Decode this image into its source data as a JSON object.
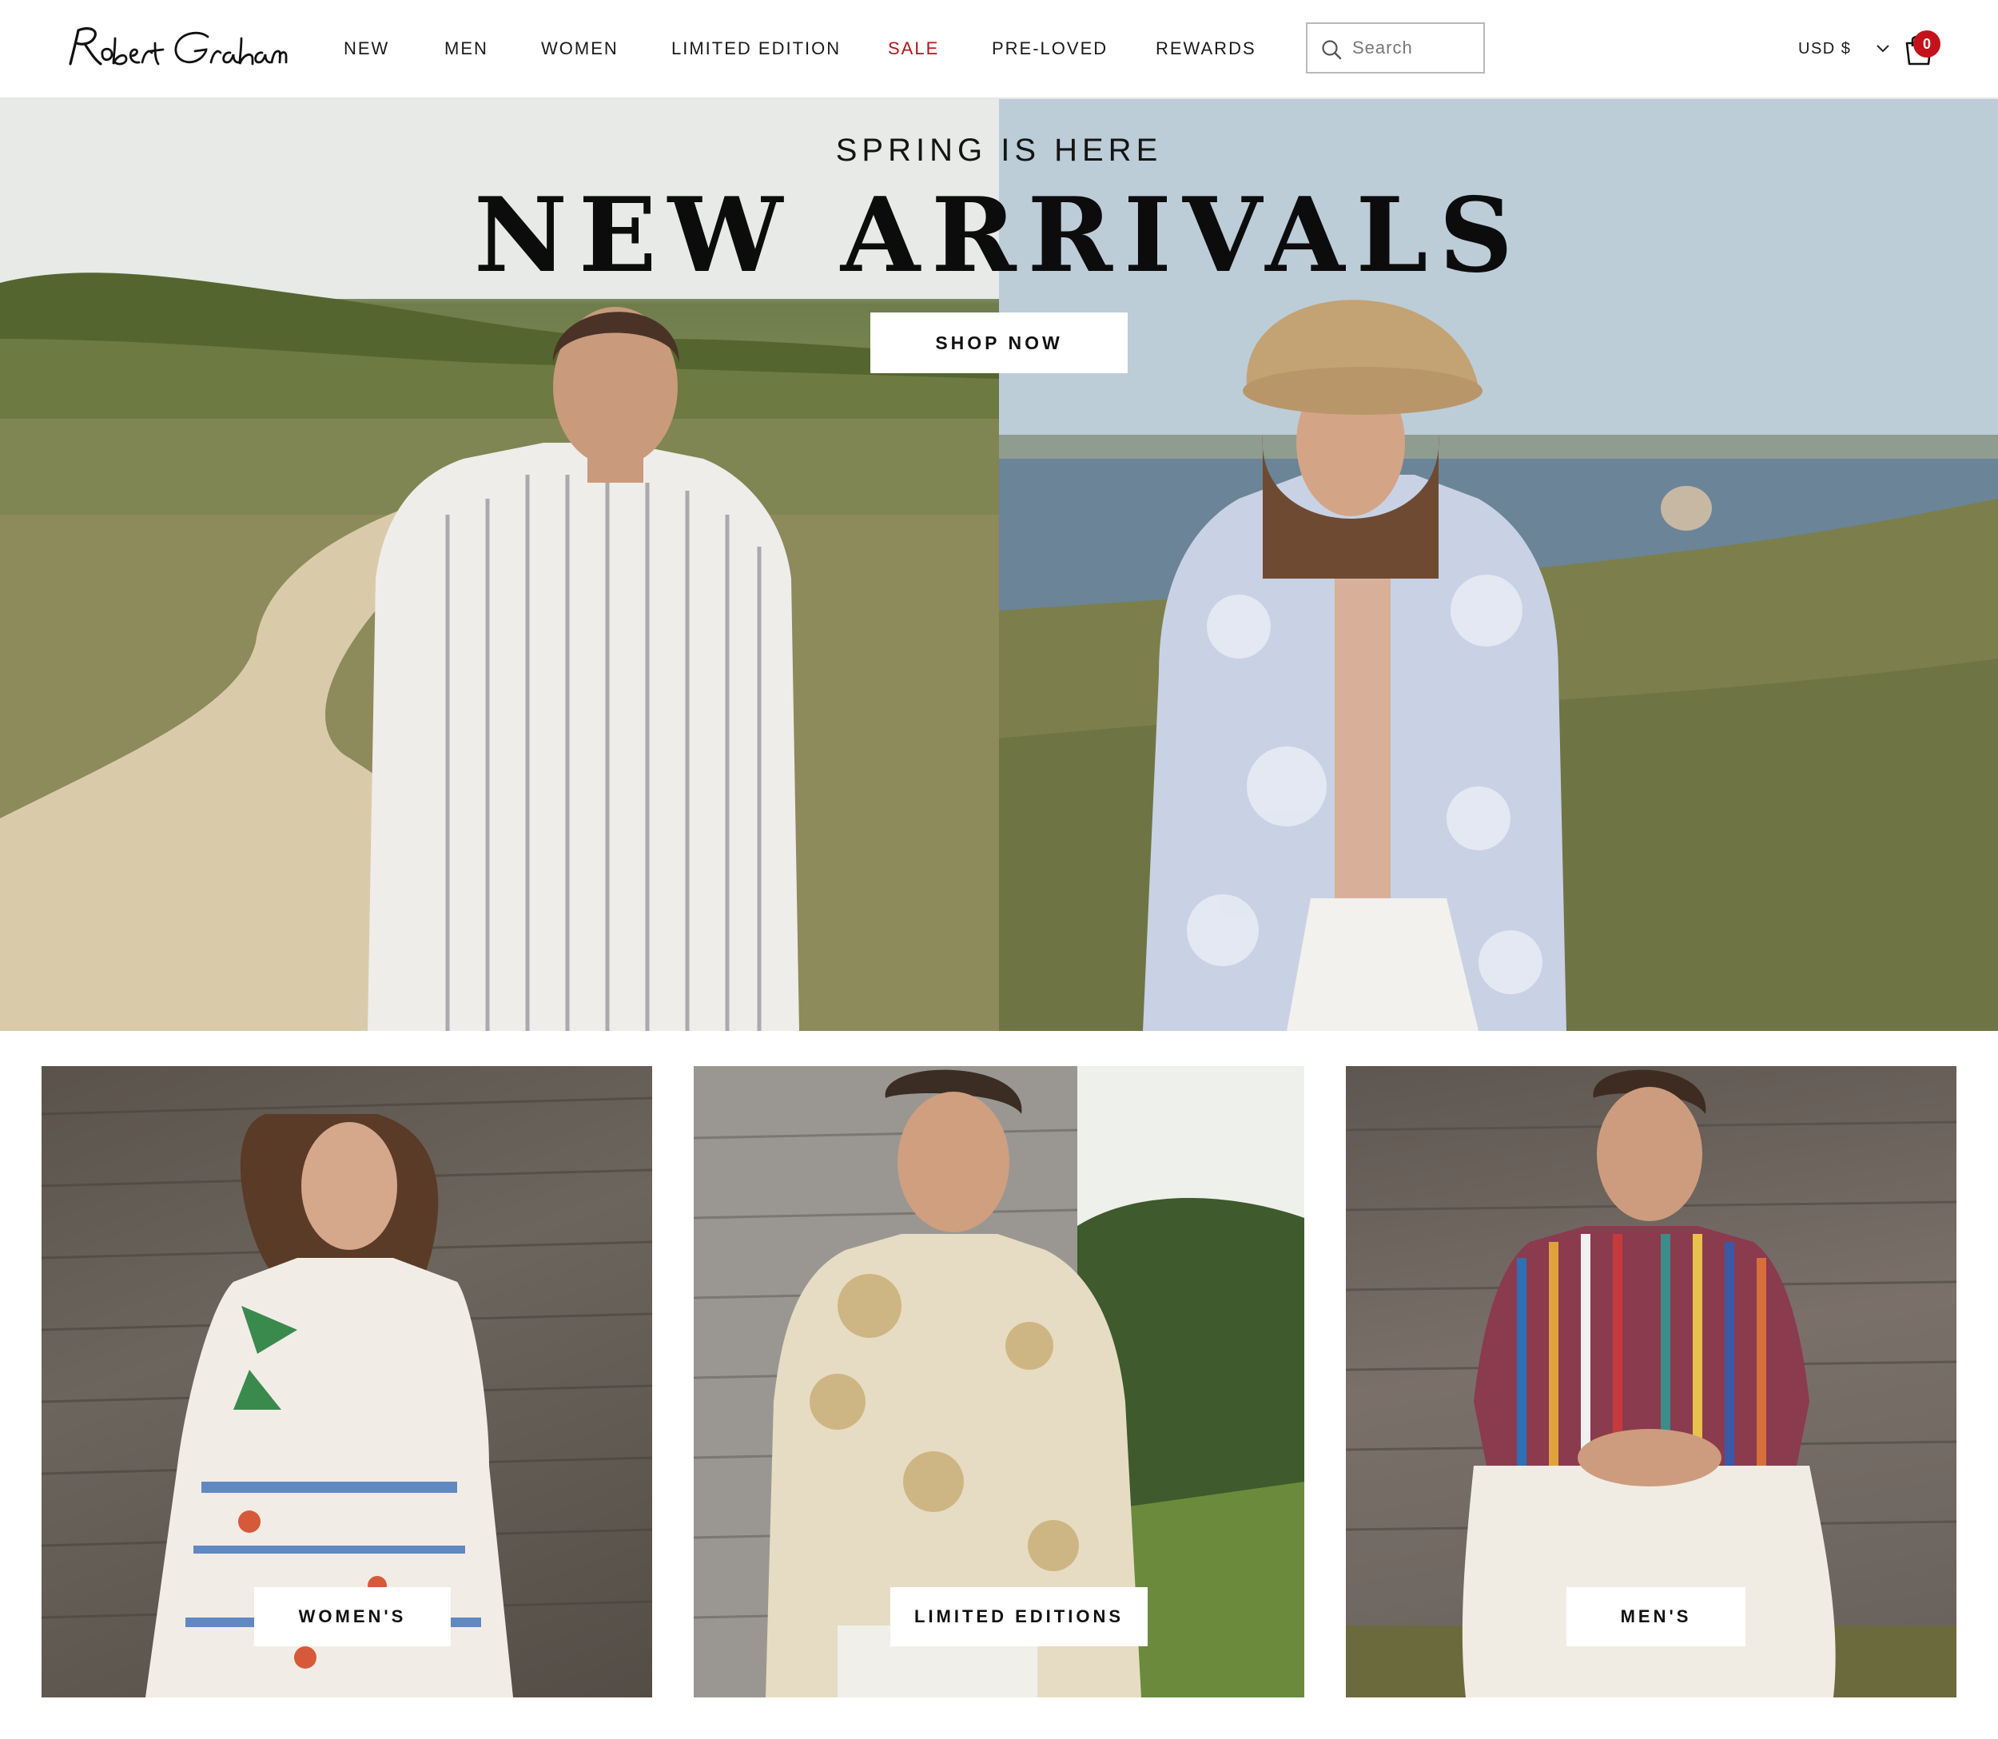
{
  "brand": {
    "logo_text": "Robert Graham"
  },
  "nav": {
    "items": [
      {
        "label": "NEW"
      },
      {
        "label": "MEN"
      },
      {
        "label": "WOMEN"
      },
      {
        "label": "LIMITED EDITION"
      },
      {
        "label": "SALE"
      },
      {
        "label": "PRE-LOVED"
      },
      {
        "label": "REWARDS"
      }
    ]
  },
  "search": {
    "placeholder": "Search",
    "icon": "search-icon"
  },
  "currency": {
    "label": "USD $",
    "icon": "chevron-down-icon"
  },
  "cart": {
    "icon": "shopping-bag-icon",
    "count": "0"
  },
  "hero": {
    "kicker": "SPRING IS HERE",
    "title": "NEW ARRIVALS",
    "cta": "SHOP NOW"
  },
  "tiles": [
    {
      "label": "WOMEN'S"
    },
    {
      "label": "LIMITED EDITIONS"
    },
    {
      "label": "MEN'S"
    }
  ],
  "colors": {
    "sale": "#b3141b",
    "badge": "#c4121a",
    "text": "#111111",
    "background": "#ffffff"
  }
}
